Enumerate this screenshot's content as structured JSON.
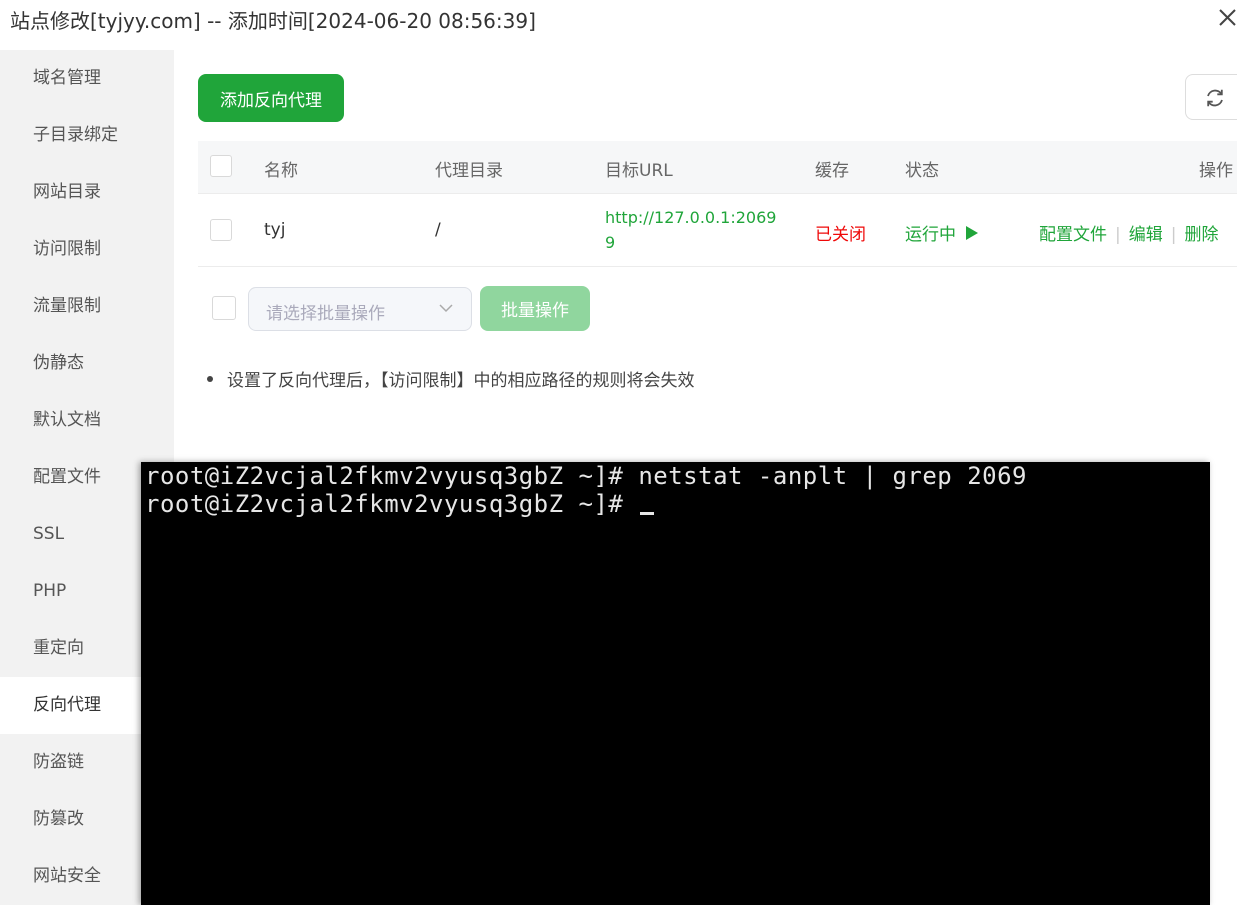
{
  "window": {
    "title": "站点修改[tyjyy.com] -- 添加时间[2024-06-20 08:56:39]",
    "close_icon": "close-icon"
  },
  "sidebar": {
    "items": [
      {
        "label": "域名管理"
      },
      {
        "label": "子目录绑定"
      },
      {
        "label": "网站目录"
      },
      {
        "label": "访问限制"
      },
      {
        "label": "流量限制"
      },
      {
        "label": "伪静态"
      },
      {
        "label": "默认文档"
      },
      {
        "label": "配置文件"
      },
      {
        "label": "SSL"
      },
      {
        "label": "PHP"
      },
      {
        "label": "重定向"
      },
      {
        "label": "反向代理",
        "active": true
      },
      {
        "label": "防盗链"
      },
      {
        "label": "防篡改"
      },
      {
        "label": "网站安全"
      }
    ]
  },
  "toolbar": {
    "add_label": "添加反向代理",
    "refresh_icon": "refresh-icon"
  },
  "table": {
    "headers": {
      "name": "名称",
      "dir": "代理目录",
      "url": "目标URL",
      "cache": "缓存",
      "status": "状态",
      "ops": "操作"
    },
    "rows": [
      {
        "name": "tyj",
        "dir": "/",
        "url": "http://127.0.0.1:20699",
        "cache": "已关闭",
        "status": "运行中",
        "status_icon": "play-icon",
        "op_config": "配置文件",
        "op_edit": "编辑",
        "op_delete": "删除",
        "sep": "|"
      }
    ]
  },
  "batch": {
    "placeholder": "请选择批量操作",
    "button_label": "批量操作"
  },
  "tip": "设置了反向代理后，【访问限制】中的相应路径的规则将会失效",
  "terminal": {
    "lines": [
      "root@iZ2vcjal2fkmv2vyusq3gbZ ~]# netstat -anplt | grep 2069",
      "root@iZ2vcjal2fkmv2vyusq3gbZ ~]# "
    ]
  },
  "colors": {
    "primary": "#20a53a",
    "primary_disabled": "#90d69e",
    "danger": "#ef0808",
    "sidebar_bg": "#f2f2f2",
    "terminal_bg": "#000000"
  }
}
